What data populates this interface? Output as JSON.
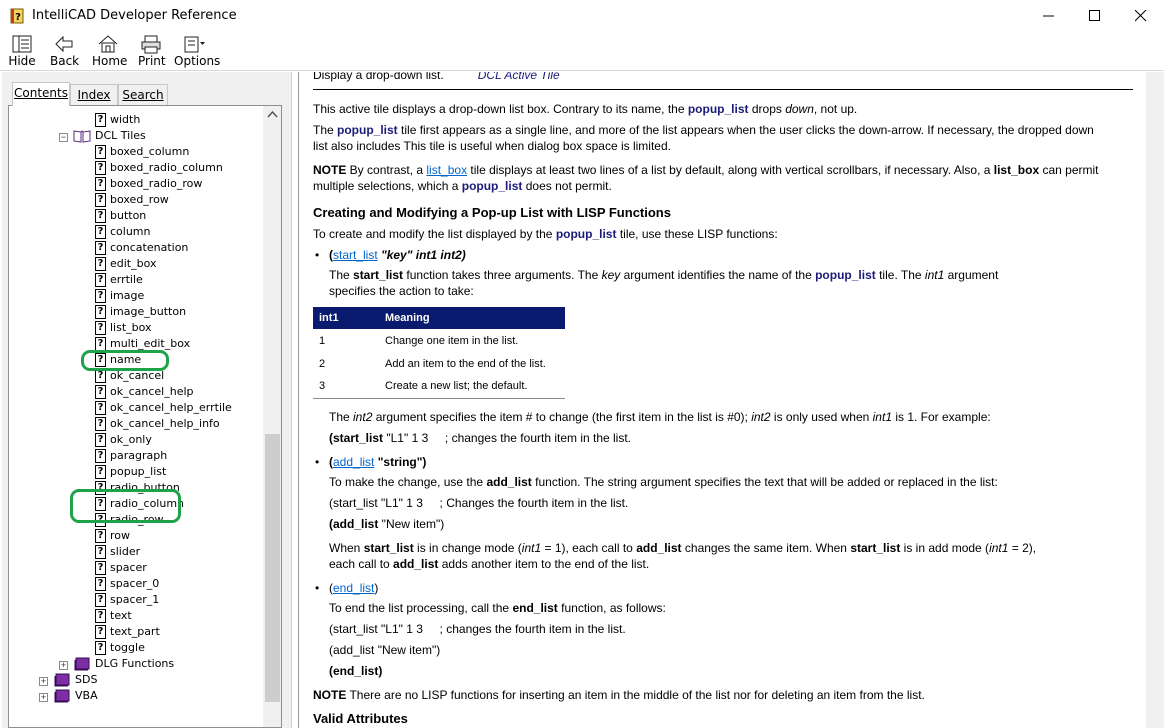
{
  "window": {
    "title": "IntelliCAD Developer Reference"
  },
  "toolbar": {
    "hide": "Hide",
    "back": "Back",
    "home": "Home",
    "print": "Print",
    "options": "Options"
  },
  "tabs": {
    "contents": "Contents",
    "index": "Index",
    "search": "Search"
  },
  "tree": {
    "width": "width",
    "dcl_tiles": "DCL Tiles",
    "items": [
      "boxed_column",
      "boxed_radio_column",
      "boxed_radio_row",
      "boxed_row",
      "button",
      "column",
      "concatenation",
      "edit_box",
      "errtile",
      "image",
      "image_button",
      "list_box",
      "multi_edit_box",
      "name",
      "ok_cancel",
      "ok_cancel_help",
      "ok_cancel_help_errtile",
      "ok_cancel_help_info",
      "ok_only",
      "paragraph",
      "popup_list",
      "radio_button",
      "radio_column",
      "radio_row",
      "row",
      "slider",
      "spacer",
      "spacer_0",
      "spacer_1",
      "text",
      "text_part",
      "toggle"
    ],
    "dlg_functions": "DLG Functions",
    "sds": "SDS",
    "vba": "VBA"
  },
  "content": {
    "top_partial": "Display a drop-down list.",
    "top_partial_italic": "DCL Active Tile",
    "p1_a": "This active tile displays a drop-down list box. Contrary to its name, the ",
    "p1_kw": "popup_list",
    "p1_b": " drops ",
    "p1_em": "down",
    "p1_c": ", not up.",
    "p2_a": "The ",
    "p2_kw": "popup_list",
    "p2_b": " tile first appears as a single line, and more of the list appears when the user clicks the down-arrow. If necessary, the dropped down",
    "p2_line2": "list also includes This tile is useful when dialog box space is limited.",
    "note1_label": "NOTE",
    "note1_a": " By contrast, a ",
    "note1_link": "list_box",
    "note1_b": " tile displays at least two lines of a list by default, along with vertical scrollbars, if necessary. Also, a ",
    "note1_kw": "list_box",
    "note1_c": " can permit",
    "note1_line2_a": "multiple selections, which a ",
    "note1_line2_kw": "popup_list",
    "note1_line2_b": " does not permit.",
    "heading": "Creating and Modifying a Pop-up List with LISP Functions",
    "intro_a": "To create and modify the list displayed by the ",
    "intro_kw": "popup_list",
    "intro_b": " tile, use these LISP functions:",
    "b1_open": "(",
    "b1_link": "start_list",
    "b1_args": " \"key\" int1 int2)",
    "b1_desc_a": "The ",
    "b1_desc_kw": "start_list",
    "b1_desc_b": " function takes three arguments. The ",
    "b1_desc_key": "key",
    "b1_desc_c": " argument identifies the name of the ",
    "b1_desc_kw2": "popup_list",
    "b1_desc_d": " tile. The ",
    "b1_desc_int1": "int1",
    "b1_desc_e": " argument",
    "b1_desc_line2": "specifies the action to take:",
    "table": {
      "headers": [
        "int1",
        "Meaning"
      ],
      "rows": [
        [
          "1",
          "Change one item in the list."
        ],
        [
          "2",
          "Add an item to the end of the list."
        ],
        [
          "3",
          "Create a new list; the default."
        ]
      ]
    },
    "int2_a": "The ",
    "int2_em": "int2",
    "int2_b": " argument specifies the item # to change (the first item in the list is #0); ",
    "int2_em2": "int2",
    "int2_c": " is only used when ",
    "int2_em3": "int1",
    "int2_d": " is 1. For example:",
    "ex1_kw": "(start_list",
    "ex1_rest": " \"L1\" 1 3     ; changes the fourth item in the list.",
    "b2_open": "(",
    "b2_link": "add_list",
    "b2_rest": " \"string\")",
    "b2_desc_a": "To make the change, use the ",
    "b2_desc_kw": "add_list",
    "b2_desc_b": " function. The string argument specifies the text that will be added or replaced in the list:",
    "ex2": "(start_list \"L1\" 1 3     ; Changes the fourth item in the list.",
    "ex3_kw": "(add_list",
    "ex3_rest": " \"New item\")",
    "when_a": "When ",
    "when_kw1": "start_list",
    "when_b": " is in change mode (",
    "when_em1": "int1",
    "when_c": " = 1), each call to ",
    "when_kw2": "add_list",
    "when_d": " changes the same item. When ",
    "when_kw3": "start_list",
    "when_e": " is in add mode (",
    "when_em2": "int1",
    "when_f": " = 2),",
    "when2_a": "each call to ",
    "when2_kw": "add_list",
    "when2_b": " adds another item to the end of the list.",
    "b3_open": "(",
    "b3_link": "end_list",
    "b3_close": ")",
    "b3_desc_a": "To end the list processing, call the ",
    "b3_desc_kw": "end_list",
    "b3_desc_b": " function, as follows:",
    "ex4": "(start_list \"L1\" 1 3     ; changes the fourth item in the list.",
    "ex5": "(add_list \"New item\")",
    "ex6": "(end_list)",
    "note2_label": "NOTE",
    "note2_text": " There are no LISP functions for inserting an item in the middle of the list nor for deleting an item from the list.",
    "valid_attr": "Valid Attributes"
  },
  "colors": {
    "keyword": "#1b1b7a",
    "link": "#0066cc",
    "table_header": "#0a1a6e",
    "highlight": "#1fa34a"
  }
}
